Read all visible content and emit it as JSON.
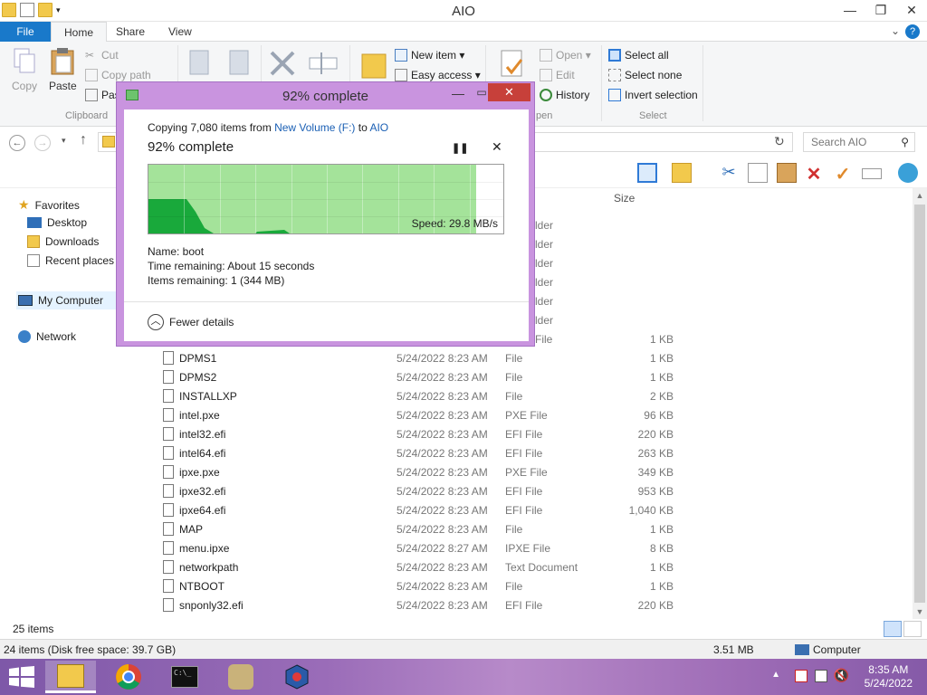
{
  "window": {
    "title": "AIO",
    "min": "—",
    "max": "❐",
    "close": "✕"
  },
  "tabs": {
    "file": "File",
    "home": "Home",
    "share": "Share",
    "view": "View"
  },
  "ribbon": {
    "copy": "Copy",
    "paste": "Paste",
    "cut": "Cut",
    "copy_path": "Copy path",
    "paste_shortcut": "Pas",
    "clipboard_group": "Clipboard",
    "new_item": "New item ▾",
    "easy_access": "Easy access ▾",
    "open": "Open ▾",
    "edit": "Edit",
    "history": "History",
    "open_group": "pen",
    "select_all": "Select all",
    "select_none": "Select none",
    "invert_selection": "Invert selection",
    "select_group": "Select"
  },
  "search": {
    "placeholder": "Search AIO"
  },
  "nav": {
    "favorites": "Favorites",
    "desktop": "Desktop",
    "downloads": "Downloads",
    "recent_places": "Recent places",
    "my_computer": "My Computer",
    "network": "Network"
  },
  "filelist": {
    "size_header": "Size",
    "partial_rows": [
      {
        "type": "lder"
      },
      {
        "type": "lder"
      },
      {
        "type": "lder"
      },
      {
        "type": "lder"
      },
      {
        "type": "lder"
      },
      {
        "type": "lder"
      },
      {
        "type": "File",
        "size": "1 KB"
      }
    ],
    "rows": [
      {
        "name": "DPMS1",
        "date": "5/24/2022 8:23 AM",
        "type": "File",
        "size": "1 KB"
      },
      {
        "name": "DPMS2",
        "date": "5/24/2022 8:23 AM",
        "type": "File",
        "size": "1 KB"
      },
      {
        "name": "INSTALLXP",
        "date": "5/24/2022 8:23 AM",
        "type": "File",
        "size": "2 KB"
      },
      {
        "name": "intel.pxe",
        "date": "5/24/2022 8:23 AM",
        "type": "PXE File",
        "size": "96 KB"
      },
      {
        "name": "intel32.efi",
        "date": "5/24/2022 8:23 AM",
        "type": "EFI File",
        "size": "220 KB"
      },
      {
        "name": "intel64.efi",
        "date": "5/24/2022 8:23 AM",
        "type": "EFI File",
        "size": "263 KB"
      },
      {
        "name": "ipxe.pxe",
        "date": "5/24/2022 8:23 AM",
        "type": "PXE File",
        "size": "349 KB"
      },
      {
        "name": "ipxe32.efi",
        "date": "5/24/2022 8:23 AM",
        "type": "EFI File",
        "size": "953 KB"
      },
      {
        "name": "ipxe64.efi",
        "date": "5/24/2022 8:23 AM",
        "type": "EFI File",
        "size": "1,040 KB"
      },
      {
        "name": "MAP",
        "date": "5/24/2022 8:23 AM",
        "type": "File",
        "size": "1 KB"
      },
      {
        "name": "menu.ipxe",
        "date": "5/24/2022 8:27 AM",
        "type": "IPXE File",
        "size": "8 KB"
      },
      {
        "name": "networkpath",
        "date": "5/24/2022 8:23 AM",
        "type": "Text Document",
        "size": "1 KB"
      },
      {
        "name": "NTBOOT",
        "date": "5/24/2022 8:23 AM",
        "type": "File",
        "size": "1 KB"
      },
      {
        "name": "snponly32.efi",
        "date": "5/24/2022 8:23 AM",
        "type": "EFI File",
        "size": "220 KB"
      }
    ]
  },
  "status": {
    "item_count": "25 items",
    "disk_info": "24 items (Disk free space: 39.7 GB)",
    "size": "3.51 MB",
    "location": "Computer"
  },
  "dialog": {
    "title": "92% complete",
    "copying_prefix": "Copying 7,080 items from ",
    "source": "New Volume (F:)",
    "to": " to ",
    "destination": "AIO",
    "percent": "92% complete",
    "progress": 0.92,
    "pause": "❚❚",
    "cancel": "✕",
    "speed": "Speed: 29.8 MB/s",
    "name": "Name:  boot",
    "time_remaining": "Time remaining:  About 15 seconds",
    "items_remaining": "Items remaining:  1 (344 MB)",
    "fewer_details": "Fewer details"
  },
  "taskbar": {
    "time": "8:35 AM",
    "date": "5/24/2022"
  },
  "colors": {
    "accent": "#1979ca",
    "dialog_frame": "#c994df",
    "progress_fill": "#a4e39a",
    "speed_graph": "#19a93b",
    "close_red": "#c7403a"
  }
}
